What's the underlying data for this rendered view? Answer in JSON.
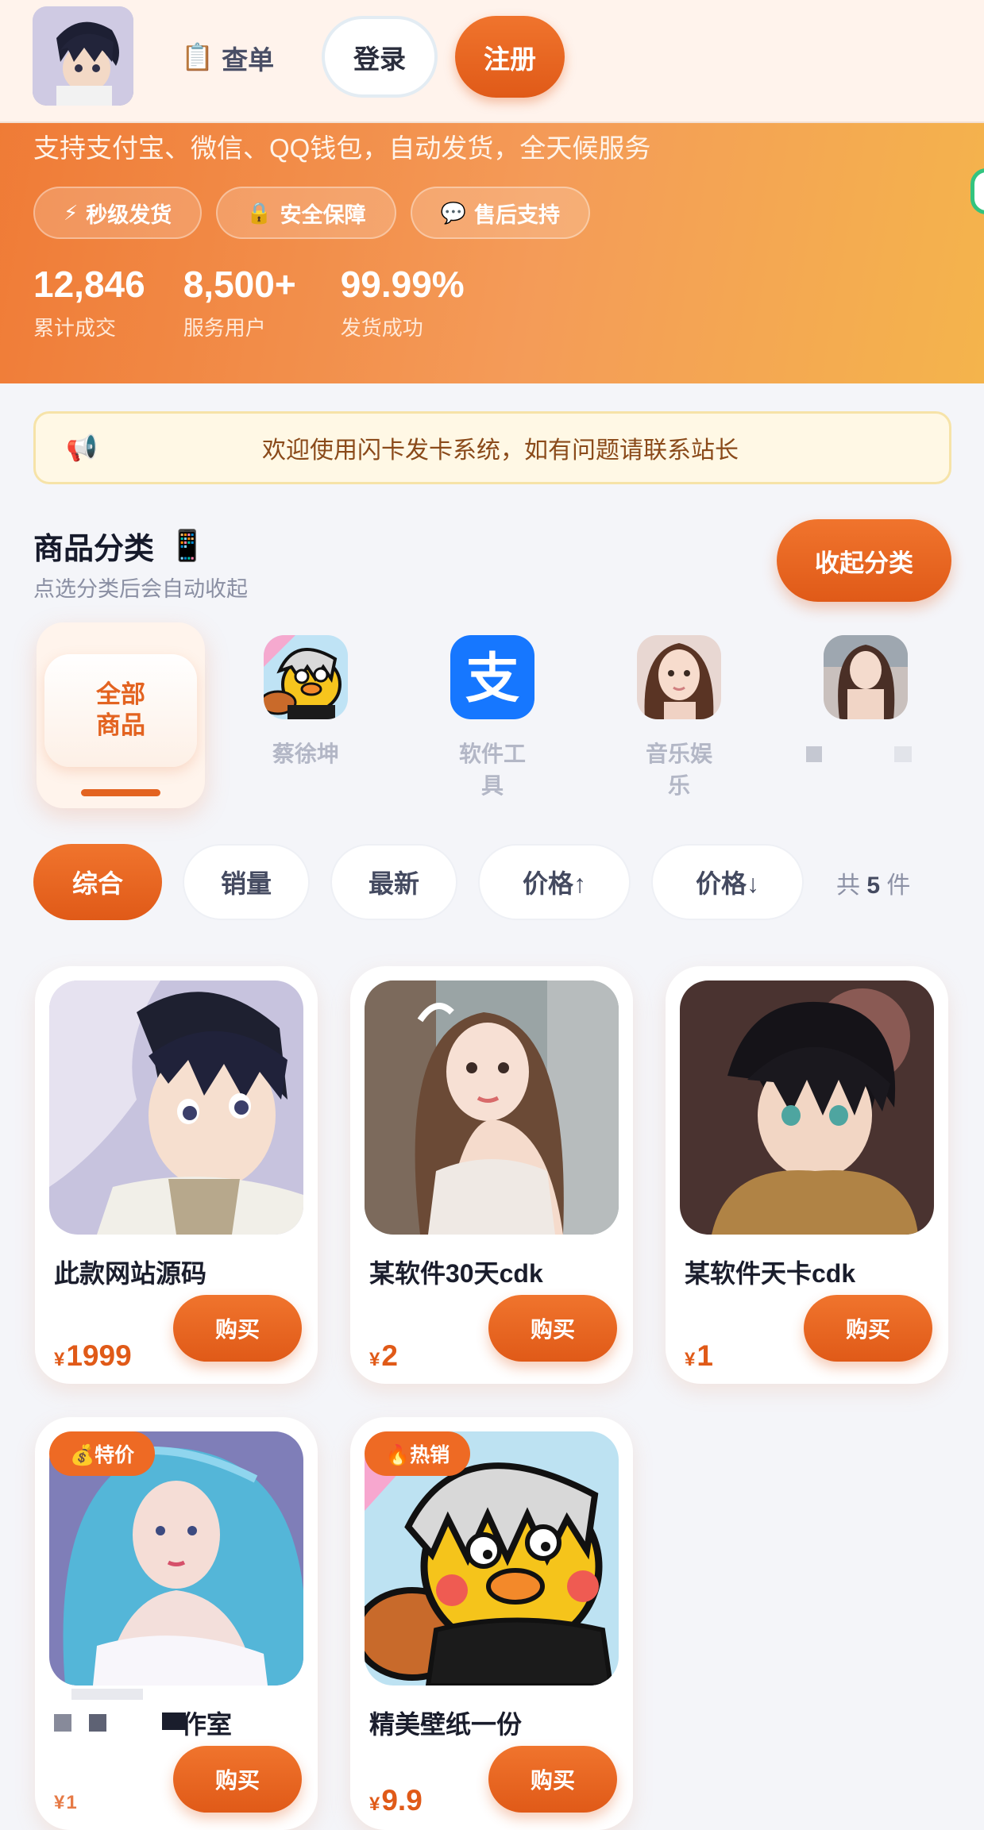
{
  "header": {
    "order_label": "查单",
    "order_icon": "clipboard-icon",
    "login_label": "登录",
    "register_label": "注册"
  },
  "hero": {
    "subtitle": "支持支付宝、微信、QQ钱包，自动发货，全天候服务",
    "chips": [
      {
        "icon": "⚡",
        "label": "秒级发货"
      },
      {
        "icon": "🔒",
        "label": "安全保障"
      },
      {
        "icon": "💬",
        "label": "售后支持"
      }
    ],
    "stats": [
      {
        "value": "12,846",
        "label": "累计成交"
      },
      {
        "value": "8,500+",
        "label": "服务用户"
      },
      {
        "value": "99.99%",
        "label": "发货成功"
      }
    ]
  },
  "notice": {
    "icon": "📢",
    "text": "欢迎使用闪卡发卡系统，如有问题请联系站长"
  },
  "categories": {
    "title": "商品分类",
    "title_icon": "📱",
    "subtitle": "点选分类后会自动收起",
    "collapse_label": "收起分类",
    "all_label": "全部\n商品",
    "items": [
      {
        "label": "蔡徐坤"
      },
      {
        "label": "软件工具"
      },
      {
        "label": "音乐娱乐"
      },
      {
        "label": ""
      }
    ]
  },
  "filters": {
    "items": [
      "综合",
      "销量",
      "最新",
      "价格↑",
      "价格↓"
    ],
    "total_prefix": "共",
    "total_count": "5",
    "total_suffix": "件"
  },
  "products": [
    {
      "name": "此款网站源码",
      "currency": "¥",
      "price": "1999",
      "buy": "购买",
      "badge": ""
    },
    {
      "name": "某软件30天cdk",
      "currency": "¥",
      "price": "2",
      "buy": "购买",
      "badge": ""
    },
    {
      "name": "某软件天卡cdk",
      "currency": "¥",
      "price": "1",
      "buy": "购买",
      "badge": ""
    },
    {
      "name": "作室",
      "currency": "¥",
      "price": "1",
      "buy": "购买",
      "badge": "💰特价"
    },
    {
      "name": "精美壁纸一份",
      "currency": "¥",
      "price": "9.9",
      "buy": "购买",
      "badge": "🔥热销"
    }
  ],
  "colors": {
    "accent": "#e05a18",
    "hero_start": "#ef7a35",
    "hero_end": "#f4b44c"
  }
}
